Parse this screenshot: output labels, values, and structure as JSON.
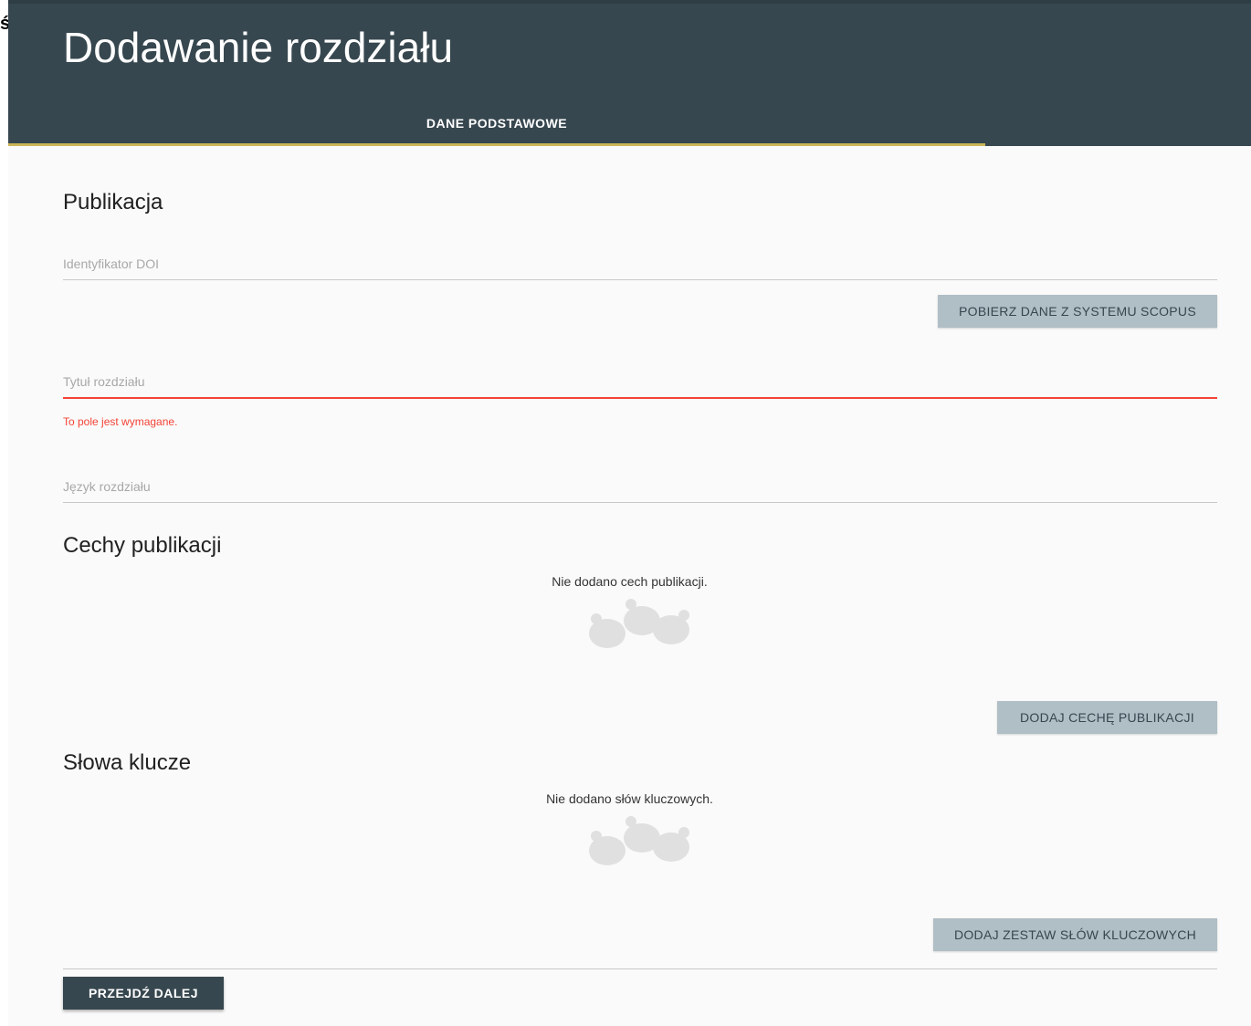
{
  "stray_glyph": "ś",
  "header": {
    "title": "Dodawanie rozdziału",
    "tabs": [
      {
        "label": "DANE PODSTAWOWE",
        "active": true
      }
    ]
  },
  "colors": {
    "header_bg": "#37474f",
    "tab_indicator": "#c9b458",
    "error": "#f44336",
    "secondary_button": "#b0bec5",
    "primary_button": "#37474f"
  },
  "publication": {
    "title": "Publikacja",
    "doi_field": {
      "placeholder": "Identyfikator DOI",
      "value": ""
    },
    "scopus_button": "POBIERZ DANE Z SYSTEMU SCOPUS",
    "chapter_title_field": {
      "placeholder": "Tytuł rozdziału",
      "value": ""
    },
    "chapter_title_error": "To pole jest wymagane.",
    "language_field": {
      "placeholder": "Język rozdziału",
      "value": ""
    }
  },
  "features": {
    "title": "Cechy publikacji",
    "empty_text": "Nie dodano cech publikacji.",
    "empty_icon": "empty-state-illustration",
    "add_button": "DODAJ CECHĘ PUBLIKACJI"
  },
  "keywords": {
    "title": "Słowa klucze",
    "empty_text": "Nie dodano słów kluczowych.",
    "empty_icon": "empty-state-illustration",
    "add_button": "DODAJ ZESTAW SŁÓW KLUCZOWYCH"
  },
  "footer": {
    "next_button": "PRZEJDŹ DALEJ"
  }
}
